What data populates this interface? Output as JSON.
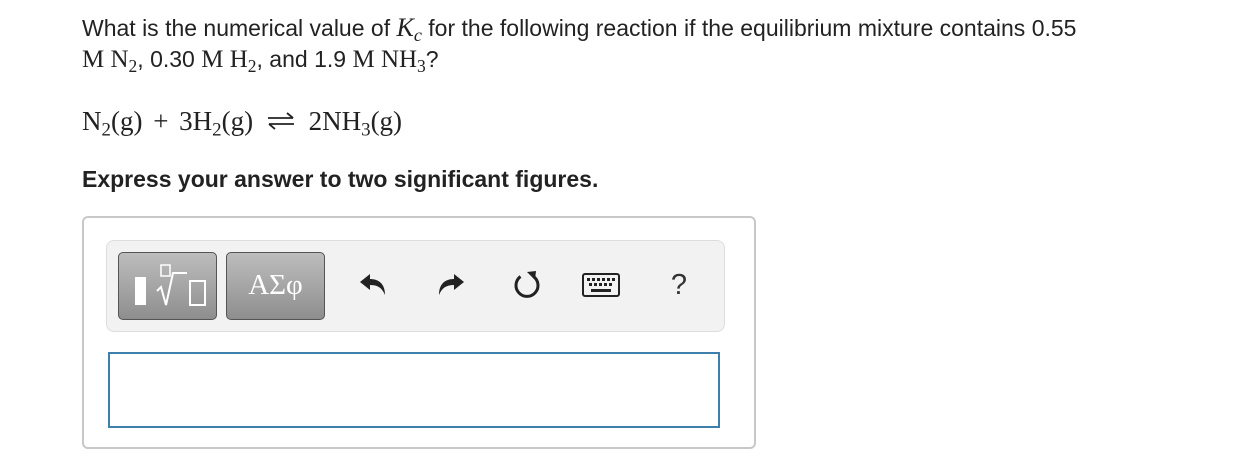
{
  "question": {
    "part1": "What is the numerical value of ",
    "kc_symbol": "K",
    "kc_sub": "c",
    "part2": " for the following reaction if the equilibrium mixture contains 0.55",
    "unit_m": "M",
    "n2_base": "N",
    "n2_sub": "2",
    "part3": ", 0.30 ",
    "h2_base": "H",
    "h2_sub": "2",
    "part4": ", and 1.9 ",
    "nh3_base": "NH",
    "nh3_sub": "3",
    "part5": "?"
  },
  "reaction": {
    "r1_base": "N",
    "r1_sub": "2",
    "r1_state": "(g)",
    "plus": "+",
    "r2_base": "3H",
    "r2_sub": "2",
    "r2_state": "(g)",
    "p1_base": "2NH",
    "p1_sub": "3",
    "p1_state": "(g)"
  },
  "instruction": "Express your answer to two significant figures.",
  "toolbar": {
    "symbols_label": "ΑΣφ",
    "help_label": "?",
    "icons": [
      "templates-icon",
      "undo-icon",
      "redo-icon",
      "reset-icon",
      "keyboard-icon",
      "help-icon"
    ]
  },
  "answer": {
    "value": ""
  }
}
